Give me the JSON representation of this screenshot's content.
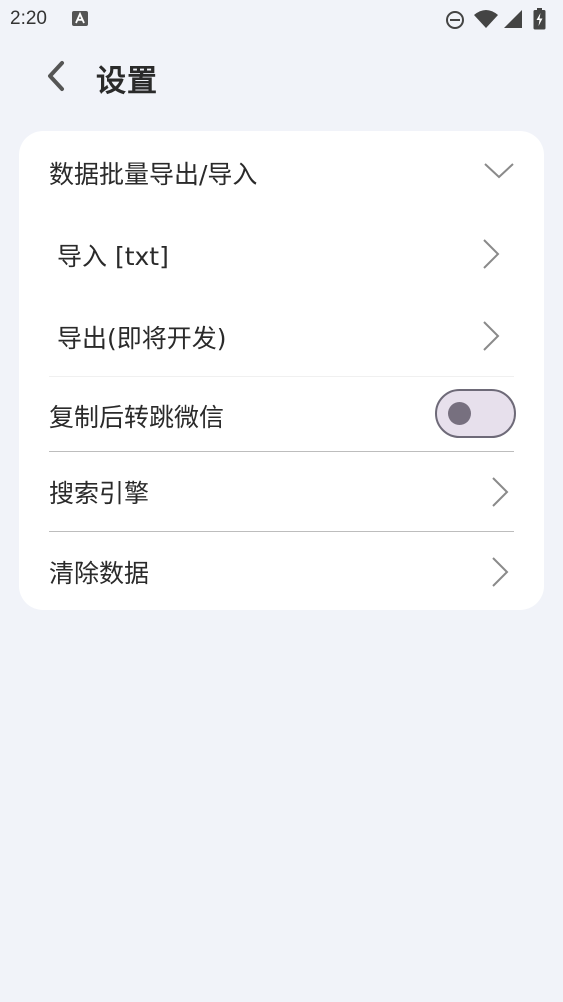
{
  "status_bar": {
    "time": "2:20",
    "icons": [
      "notification-a-icon",
      "dnd-icon",
      "wifi-icon",
      "signal-icon",
      "battery-charging-icon"
    ]
  },
  "app_bar": {
    "back_icon": "chevron-left-icon",
    "title": "设置"
  },
  "settings": {
    "batch_section": {
      "label": "数据批量导出/导入",
      "icon": "chevron-down-icon",
      "expanded": true,
      "items": [
        {
          "label": "导入 [txt]",
          "icon": "chevron-right-icon"
        },
        {
          "label": "导出(即将开发)",
          "icon": "chevron-right-icon"
        }
      ]
    },
    "wechat_toggle": {
      "label": "复制后转跳微信",
      "on": false
    },
    "search_engine": {
      "label": "搜索引擎",
      "icon": "chevron-right-icon"
    },
    "clear_data": {
      "label": "清除数据",
      "icon": "chevron-right-icon"
    }
  },
  "colors": {
    "background": "#f1f3f9",
    "card": "#ffffff",
    "toggle_track": "#e7e0ec",
    "toggle_border": "#6e6a78",
    "toggle_knob": "#77707f",
    "chevron": "#8a8a8a"
  }
}
